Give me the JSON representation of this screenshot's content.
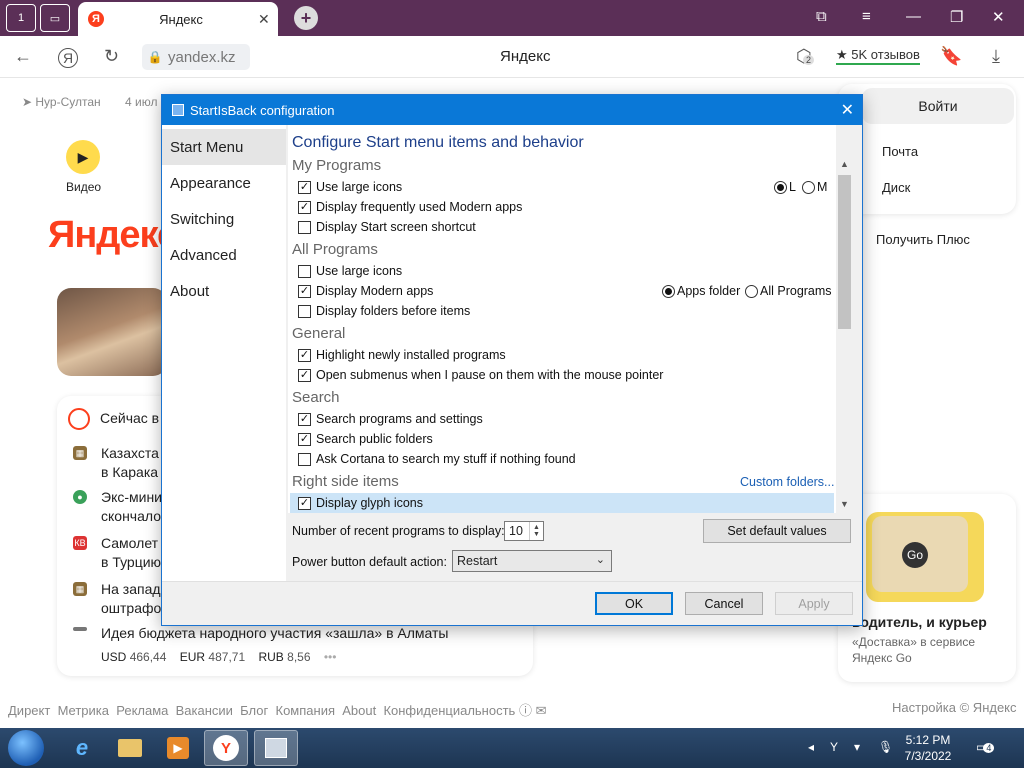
{
  "browser": {
    "tab_badge_count": "1",
    "active_tab_title": "Яндекс",
    "tab_logo_letter": "Я",
    "new_tab_symbol": "+",
    "address_url": "yandex.kz",
    "center_title": "Яндекс",
    "reviews_label": "5K отзывов",
    "reviews_star": "★",
    "ext_badge": "2"
  },
  "page": {
    "location": "Нур-Султан",
    "date_fragment": "4 июл",
    "video_label": "Видео",
    "logo_main": "Яндекс",
    "news_title": "Сейчас в",
    "news": [
      {
        "line1": "Казахста",
        "line2": "в Карака"
      },
      {
        "line1": "Экс-мини",
        "line2": "скончало"
      },
      {
        "line1": "Самолет",
        "line2": "в Турцию"
      },
      {
        "line1": "На запад",
        "line2": "оштрафо"
      },
      {
        "line1": "Идея бюджета народного участия «зашла» в Алматы"
      }
    ],
    "rates": [
      {
        "cur": "USD",
        "val": "466,44"
      },
      {
        "cur": "EUR",
        "val": "487,71"
      },
      {
        "cur": "RUB",
        "val": "8,56"
      }
    ],
    "rates_more": "•••",
    "login_button": "Войти",
    "mail_link": "Почта",
    "disk_link": "Диск",
    "plus_link": "Получить Плюс",
    "promo_title": "водитель, и курьер",
    "promo_sub": "«Доставка» в сервисе Яндекс Go",
    "promo_badge": "Go",
    "footer_left": [
      "Директ",
      "Метрика",
      "Реклама",
      "Вакансии",
      "Блог",
      "Компания",
      "About",
      "Конфиденциальность"
    ],
    "footer_right": "Настройка  © Яндекс"
  },
  "dialog": {
    "title": "StartIsBack configuration",
    "nav": [
      "Start Menu",
      "Appearance",
      "Switching",
      "Advanced",
      "About"
    ],
    "active_nav": "Start Menu",
    "heading": "Configure Start menu items and behavior",
    "sections": {
      "my_programs": "My Programs",
      "all_programs": "All Programs",
      "general": "General",
      "search": "Search",
      "right_side": "Right side items"
    },
    "options": {
      "mp_large_icons": {
        "label": "Use large icons",
        "checked": true
      },
      "mp_modern_apps": {
        "label": "Display frequently used Modern apps",
        "checked": true
      },
      "mp_start_screen": {
        "label": "Display Start screen shortcut",
        "checked": false
      },
      "ap_large_icons": {
        "label": "Use large icons",
        "checked": false
      },
      "ap_modern_apps": {
        "label": "Display Modern apps",
        "checked": true
      },
      "ap_folders_first": {
        "label": "Display folders before items",
        "checked": false
      },
      "gen_highlight": {
        "label": "Highlight newly installed programs",
        "checked": true
      },
      "gen_submenus": {
        "label": "Open submenus when I pause on them with the mouse pointer",
        "checked": true
      },
      "s_programs": {
        "label": "Search programs and settings",
        "checked": true
      },
      "s_public": {
        "label": "Search public folders",
        "checked": true
      },
      "s_cortana": {
        "label": "Ask Cortana to search my stuff if nothing found",
        "checked": false
      },
      "rs_glyph": {
        "label": "Display glyph icons",
        "checked": true
      }
    },
    "size_radio": {
      "l_label": "L",
      "m_label": "M",
      "selected": "L"
    },
    "modern_radio": {
      "apps_folder": "Apps folder",
      "all_programs": "All Programs",
      "selected": "Apps folder"
    },
    "custom_folders_link": "Custom folders...",
    "recent_label": "Number of recent programs to display:",
    "recent_value": "10",
    "power_label": "Power button default action:",
    "power_value": "Restart",
    "set_default_button": "Set default values",
    "ok_button": "OK",
    "cancel_button": "Cancel",
    "apply_button": "Apply"
  },
  "taskbar": {
    "time": "5:12 PM",
    "date": "7/3/2022",
    "notif_count": "4"
  }
}
